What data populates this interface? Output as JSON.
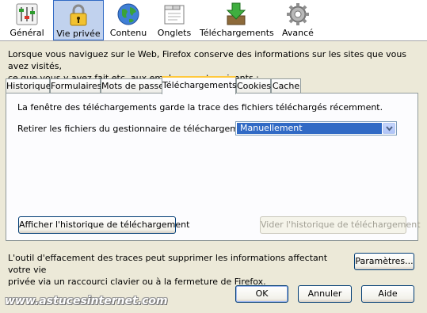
{
  "toolbar": {
    "items": [
      {
        "label": "Général",
        "icon": "general-switches-icon"
      },
      {
        "label": "Vie privée",
        "icon": "padlock-icon",
        "selected": true
      },
      {
        "label": "Contenu",
        "icon": "globe-icon"
      },
      {
        "label": "Onglets",
        "icon": "tabs-window-icon"
      },
      {
        "label": "Téléchargements",
        "icon": "download-arrow-icon"
      },
      {
        "label": "Avancé",
        "icon": "gear-icon"
      }
    ]
  },
  "intro_text_line1": "Lorsque vous naviguez sur le Web, Firefox conserve des informations sur les sites que vous avez visités,",
  "intro_text_line2": "ce que vous y avez fait etc. aux emplacements suivants :",
  "tabs": [
    {
      "label": "Historique"
    },
    {
      "label": "Formulaires"
    },
    {
      "label": "Mots de passe"
    },
    {
      "label": "Téléchargements",
      "active": true
    },
    {
      "label": "Cookies"
    },
    {
      "label": "Cache"
    }
  ],
  "panel": {
    "description": "La fenêtre des téléchargements garde la trace des fichiers téléchargés récemment.",
    "retirer_label": "Retirer les fichiers du gestionnaire de téléchargements",
    "retirer_select_value": "Manuellement",
    "show_history_button": "Afficher l'historique de téléchargement",
    "clear_history_button": "Vider l'historique de téléchargement"
  },
  "footer_text_line1": "L'outil d'effacement des traces peut supprimer les informations affectant votre vie",
  "footer_text_line2": "privée via un raccourci clavier ou à la fermeture de Firefox.",
  "buttons": {
    "parametres": "Paramètres...",
    "ok": "OK",
    "annuler": "Annuler",
    "aide": "Aide"
  },
  "watermark": "www.astucesinternet.com",
  "colors": {
    "dialog_bg": "#ece9d8",
    "selection_blue": "#316ac5",
    "tab_highlight": "#ffc83c"
  }
}
